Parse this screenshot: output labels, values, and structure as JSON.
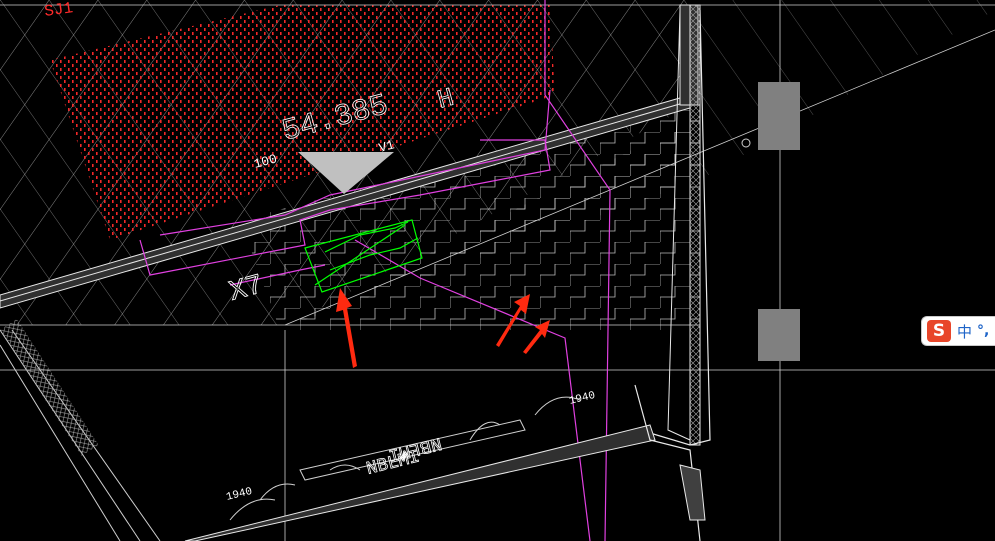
{
  "drawing": {
    "top_left_label": "SJ1",
    "area_label": "54.385",
    "area_label_suffix": "H",
    "small_label_1": "100",
    "small_label_2": "V1",
    "grid_marker": "X7",
    "room_tag": "NBLMI",
    "room_tag_mirror": "NBLMI",
    "dim_left": "1940",
    "dim_right": "1940"
  },
  "colors": {
    "background": "#000000",
    "linework": "#ffffff",
    "hatch": "#ff2a2a",
    "boundary": "#e040e0",
    "selection": "#00ff00",
    "annotation_arrow": "#ff2a10",
    "column_fill": "#808080"
  },
  "ime": {
    "logo": "S",
    "mode": "中",
    "punct": "°,"
  },
  "icons": [
    "cad-arrow-icon",
    "sogou-ime-icon"
  ]
}
